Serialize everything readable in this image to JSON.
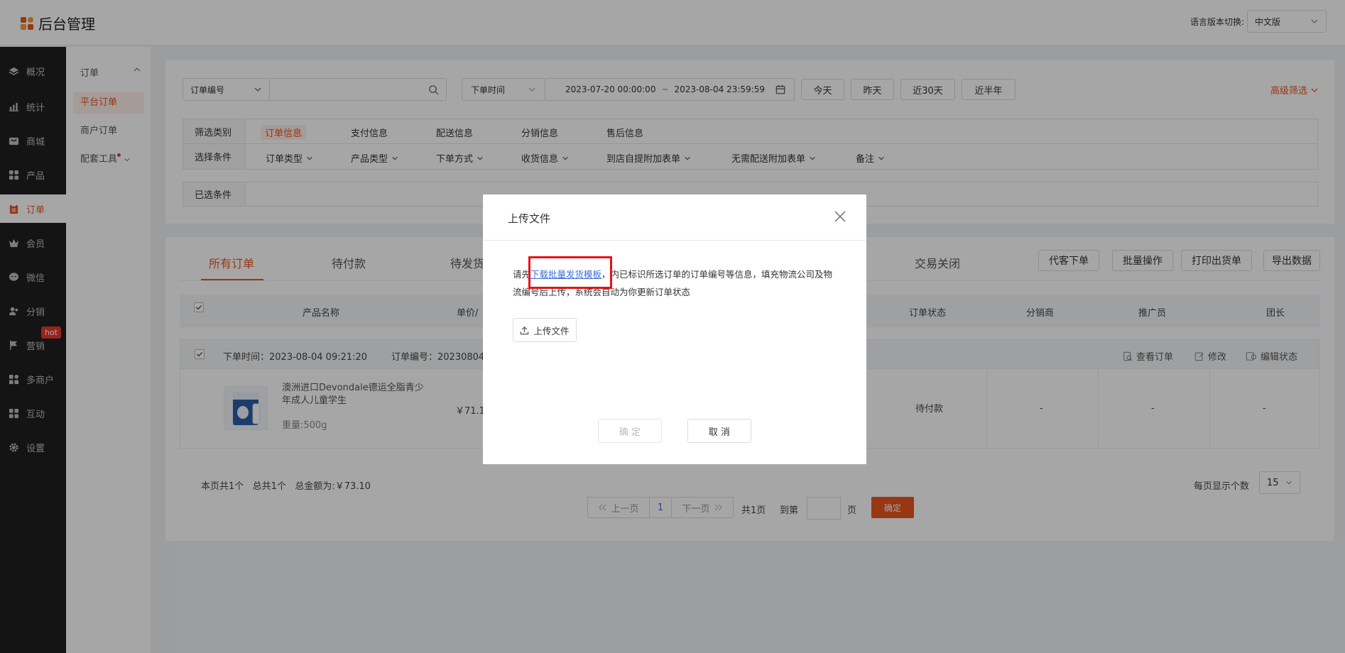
{
  "app": {
    "title": "后台管理"
  },
  "header": {
    "lang_label": "语言版本切换:",
    "lang_value": "中文版"
  },
  "sidebar": {
    "items": [
      {
        "label": "概况",
        "icon": "layers-icon"
      },
      {
        "label": "统计",
        "icon": "chart-icon"
      },
      {
        "label": "商城",
        "icon": "store-icon"
      },
      {
        "label": "产品",
        "icon": "grid-icon"
      },
      {
        "label": "订单",
        "icon": "clipboard-icon"
      },
      {
        "label": "会员",
        "icon": "crown-icon"
      },
      {
        "label": "微信",
        "icon": "wechat-icon"
      },
      {
        "label": "分销",
        "icon": "users-icon"
      },
      {
        "label": "营销",
        "icon": "flag-icon"
      },
      {
        "label": "多商户",
        "icon": "merchant-icon"
      },
      {
        "label": "互动",
        "icon": "grid-icon"
      },
      {
        "label": "设置",
        "icon": "gear-icon"
      }
    ],
    "hot_badge": "hot"
  },
  "subnav": {
    "head": "订单",
    "items": [
      "平台订单",
      "商户订单",
      "配套工具"
    ]
  },
  "filters": {
    "order_no_select": "订单编号",
    "time_select": "下单时间",
    "date_start": "2023-07-20 00:00:00",
    "date_sep": "~",
    "date_end": "2023-08-04 23:59:59",
    "quick": [
      "今天",
      "昨天",
      "近30天",
      "近半年"
    ],
    "advanced": "高级筛选",
    "category_label": "筛选类别",
    "categories": [
      "订单信息",
      "支付信息",
      "配送信息",
      "分销信息",
      "售后信息"
    ],
    "condition_label": "选择条件",
    "conditions": [
      "订单类型",
      "产品类型",
      "下单方式",
      "收货信息",
      "到店自提附加表单",
      "无需配送附加表单",
      "备注"
    ],
    "selected_label": "已选条件"
  },
  "orders": {
    "tabs": [
      "所有订单",
      "待付款",
      "待发货",
      "交易关闭"
    ],
    "actions": [
      "代客下单",
      "批量操作",
      "打印出货单",
      "导出数据"
    ],
    "columns": [
      "产品名称",
      "单价/",
      "订单状态",
      "分销商",
      "推广员",
      "团长"
    ],
    "order": {
      "time": "下单时间：2023-08-04 09:21:20",
      "number": "订单编号：20230804",
      "view": "查看订单",
      "edit": "修改",
      "edit_status": "编辑状态",
      "product_name": "澳洲进口Devondale德运全脂青少年成人儿童学生",
      "weight": "重量:500g",
      "price": "￥71.10",
      "status": "待付款",
      "distributor": "-",
      "promoter": "-",
      "leader": "-"
    },
    "summary": "本页共1个   总共1个   总金额为:￥73.10",
    "pagination": {
      "prev": "上一页",
      "page": "1",
      "next": "下一页",
      "total": "共1页",
      "goto": "到第",
      "unit": "页",
      "confirm": "确定",
      "per_page_label": "每页显示个数",
      "per_page_value": "15"
    }
  },
  "modal": {
    "title": "上传文件",
    "text_prefix": "请先",
    "link": "下载批量发货模板",
    "text_suffix": "，内已标识所选订单的订单编号等信息，填充物流公司及物流编号后上传，系统会自动为你更新订单状态",
    "upload_label": "上传文件",
    "confirm": "确 定",
    "cancel": "取 消"
  },
  "colors": {
    "accent": "#e8551f",
    "sidebar": "#1f1f1f",
    "link": "#3a6fd8",
    "highlight": "#e3151a"
  }
}
